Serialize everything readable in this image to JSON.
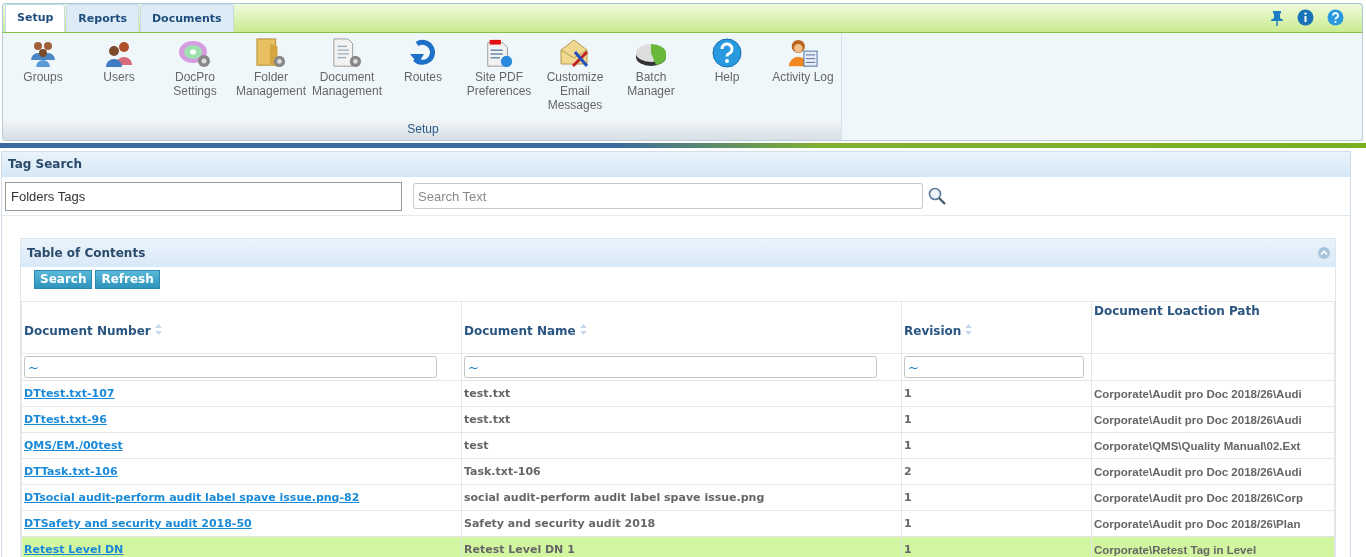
{
  "tabs": [
    {
      "label": "Setup",
      "selected": true
    },
    {
      "label": "Reports",
      "selected": false
    },
    {
      "label": "Documents",
      "selected": false
    }
  ],
  "ribbon": {
    "items": [
      "Groups",
      "Users",
      "DocPro\nSettings",
      "Folder\nManagement",
      "Document\nManagement",
      "Routes",
      "Site PDF\nPreferences",
      "Customize\nEmail\nMessages",
      "Batch\nManager",
      "Help",
      "Activity Log"
    ],
    "group_label": "Setup"
  },
  "tag_search": {
    "title": "Tag Search",
    "folders_field": "Folders Tags",
    "search": {
      "placeholder": "Search Text"
    }
  },
  "toc": {
    "title": "Table of Contents",
    "buttons": [
      "Search",
      "Refresh"
    ],
    "columns": [
      {
        "label": "Document Number",
        "sortable": true,
        "filter": "~"
      },
      {
        "label": "Document Name",
        "sortable": true,
        "filter": "~"
      },
      {
        "label": "Revision",
        "sortable": true,
        "filter": "~"
      },
      {
        "label": "Document Loaction Path",
        "sortable": false
      }
    ],
    "rows": [
      {
        "number": "DTtest.txt-107",
        "name": "test.txt",
        "revision": "1",
        "path": "Corporate\\Audit pro Doc 2018/26\\Audi",
        "selected": false
      },
      {
        "number": "DTtest.txt-96",
        "name": "test.txt",
        "revision": "1",
        "path": "Corporate\\Audit pro Doc 2018/26\\Audi",
        "selected": false
      },
      {
        "number": "QMS/EM./00test",
        "name": "test",
        "revision": "1",
        "path": "Corporate\\QMS\\Quality Manual\\02.Ext",
        "selected": false
      },
      {
        "number": "DTTask.txt-106",
        "name": "Task.txt-106",
        "revision": "2",
        "path": "Corporate\\Audit pro Doc 2018/26\\Audi",
        "selected": false
      },
      {
        "number": "DTsocial audit-perform audit label spave issue.png-82",
        "name": "social audit-perform audit label spave issue.png",
        "revision": "1",
        "path": "Corporate\\Audit pro Doc 2018/26\\Corp",
        "selected": false
      },
      {
        "number": "DTSafety and security audit 2018-50",
        "name": "Safety and security audit 2018",
        "revision": "1",
        "path": "Corporate\\Audit pro Doc 2018/26\\Plan",
        "selected": false
      },
      {
        "number": "Retest Level DN",
        "name": "Retest Level DN 1",
        "revision": "1",
        "path": "Corporate\\Retest Tag in Level",
        "selected": true
      }
    ]
  }
}
